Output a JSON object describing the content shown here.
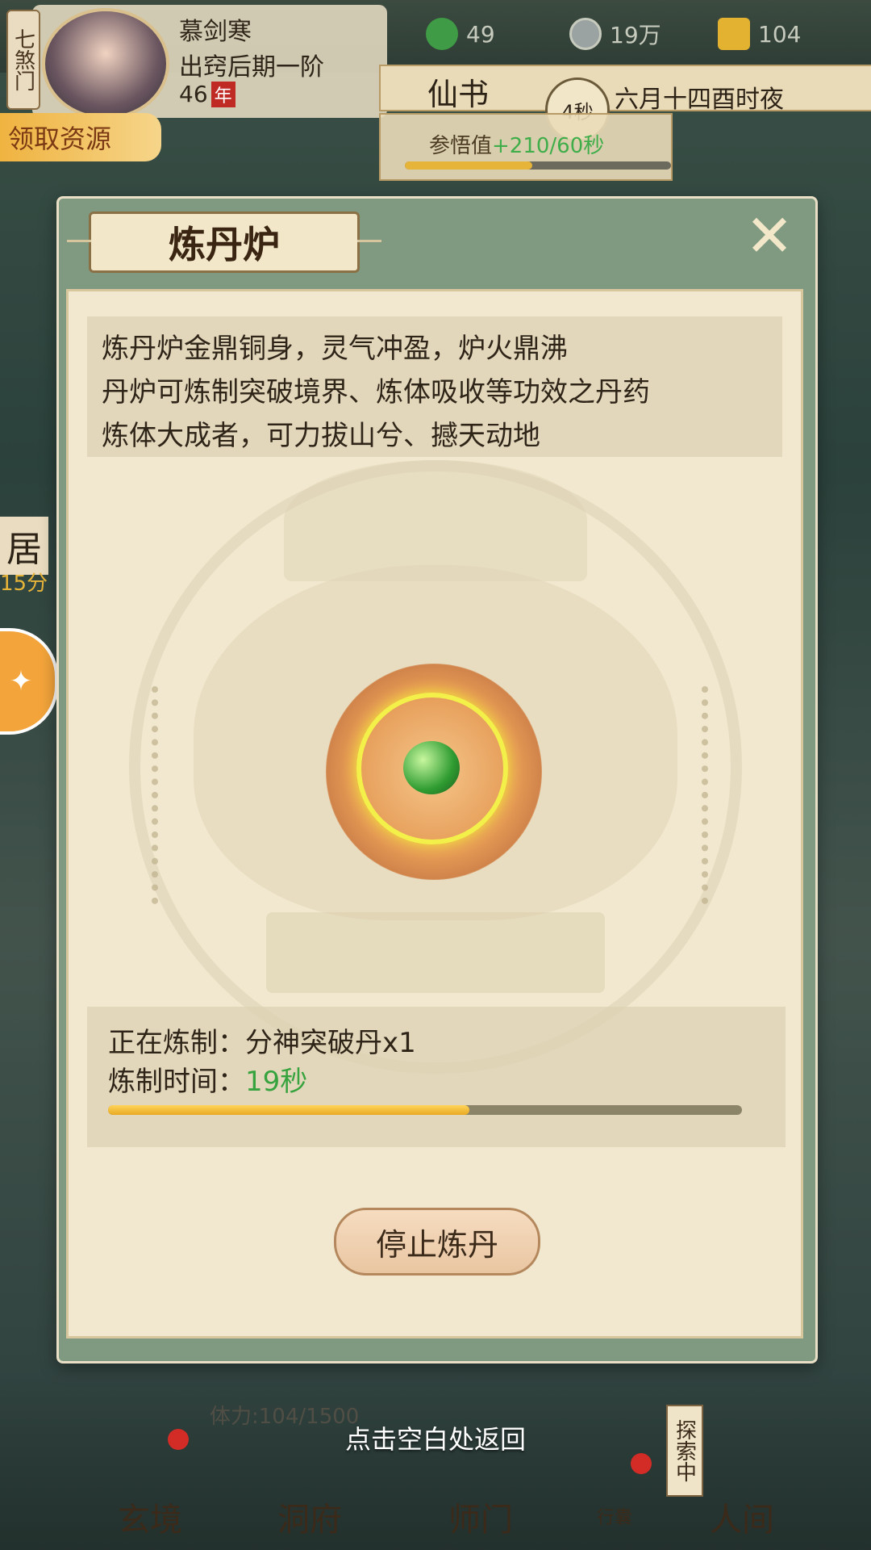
{
  "hud": {
    "sect": "七煞门",
    "player_name": "慕剑寒",
    "realm": "出窍后期一阶",
    "age": "46",
    "age_unit": "年",
    "resources": [
      {
        "icon": "leaf-icon",
        "value": "49"
      },
      {
        "icon": "coin-icon",
        "value": "19万"
      },
      {
        "icon": "ingot-icon",
        "value": "104"
      }
    ],
    "book_title": "仙书",
    "timer": "4秒",
    "date": "六月十四酉时夜",
    "insight_label": "参悟值",
    "insight_rate": "+210/60秒",
    "insight_progress": 0.48,
    "claim_label": "领取资源",
    "left_label": "居",
    "left_time": "15分"
  },
  "modal": {
    "title": "炼丹炉",
    "description": [
      "炼丹炉金鼎铜身，灵气冲盈，炉火鼎沸",
      "丹炉可炼制突破境界、炼体吸收等功效之丹药",
      "炼体大成者，可力拔山兮、撼天动地"
    ],
    "refining_label": "正在炼制：",
    "refining_item": "分神突破丹x1",
    "time_label": "炼制时间：",
    "time_value": "19秒",
    "progress": 0.57,
    "stop_button": "停止炼丹"
  },
  "bottom": {
    "return_hint": "点击空白处返回",
    "stamina": "体力:104/1500",
    "explore": "探索中",
    "nav": [
      "玄境",
      "洞府",
      "师门",
      "人间"
    ],
    "bag": "行囊"
  },
  "colors": {
    "accent_green": "#37a33f",
    "progress_gold": "#e8a923",
    "modal_frame": "#7f9a80",
    "paper": "#f1e8cf"
  }
}
